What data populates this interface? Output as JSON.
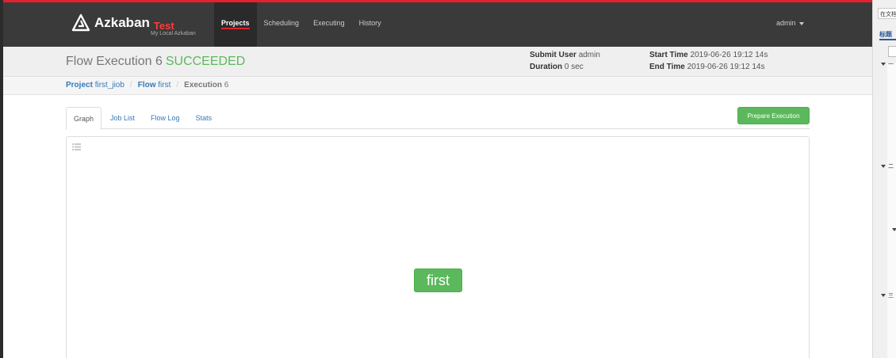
{
  "brand": {
    "name": "Azkaban",
    "env": "Test",
    "sub": "My Local Azkaban"
  },
  "nav": {
    "items": [
      {
        "label": "Projects",
        "active": true
      },
      {
        "label": "Scheduling",
        "active": false
      },
      {
        "label": "Executing",
        "active": false
      },
      {
        "label": "History",
        "active": false
      }
    ],
    "user": "admin"
  },
  "header": {
    "title": "Flow Execution 6",
    "status": "SUCCEEDED",
    "submit_user_label": "Submit User",
    "submit_user": "admin",
    "duration_label": "Duration",
    "duration": "0 sec",
    "start_time_label": "Start Time",
    "start_time": "2019-06-26 19:12 14s",
    "end_time_label": "End Time",
    "end_time": "2019-06-26 19:12 14s"
  },
  "breadcrumb": {
    "project_label": "Project",
    "project": "first_jiob",
    "flow_label": "Flow",
    "flow": "first",
    "execution_label": "Execution",
    "execution": "6",
    "separator": "/"
  },
  "tabs": [
    {
      "label": "Graph",
      "active": true
    },
    {
      "label": "Job List",
      "active": false
    },
    {
      "label": "Flow Log",
      "active": false
    },
    {
      "label": "Stats",
      "active": false
    }
  ],
  "actions": {
    "prepare_execution": "Prepare Execution"
  },
  "graph": {
    "nodes": [
      {
        "label": "first",
        "status": "SUCCEEDED"
      }
    ]
  },
  "side_panel": {
    "search_text": "在文档",
    "tab_label": "标题",
    "items": [
      "一",
      "二",
      "三"
    ]
  },
  "colors": {
    "accent_red": "#e5202e",
    "success": "#5cb85c",
    "link": "#337ab7",
    "navbar": "#3a3a3a"
  },
  "icons": {
    "brand": "azkaban-logo-icon",
    "graph_menu": "list-icon",
    "user_menu": "caret-down-icon"
  }
}
